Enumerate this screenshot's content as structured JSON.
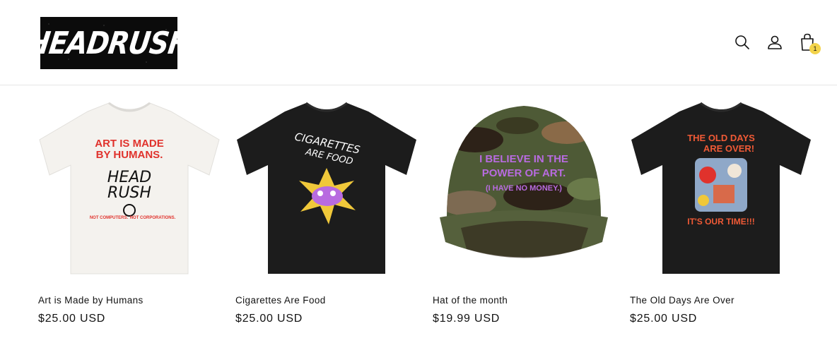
{
  "header": {
    "logo_text": "HEADRUSH",
    "icons": [
      "search-icon",
      "account-icon",
      "cart-icon"
    ],
    "cart_count": "1"
  },
  "products": [
    {
      "title": "Art is Made by Humans",
      "price": "$25.00 USD",
      "shirt_color": "#f4f2ee",
      "print_top": "ART IS MADE",
      "print_top2": "BY HUMANS.",
      "print_center1": "HEAD",
      "print_center2": "RUSH",
      "print_bottom_left": "NOT COMPUTERS.",
      "print_bottom_right": "NOT CORPORATIONS."
    },
    {
      "title": "Cigarettes Are Food",
      "price": "$25.00 USD",
      "shirt_color": "#1c1c1c",
      "print_top": "CIGARETTES",
      "print_top2": "ARE FOOD"
    },
    {
      "title": "Hat of the month",
      "price": "$19.99 USD",
      "print_line1": "I BELIEVE IN THE",
      "print_line2": "POWER OF ART.",
      "print_line3": "(I HAVE NO MONEY.)"
    },
    {
      "title": "The Old Days Are Over",
      "price": "$25.00 USD",
      "shirt_color": "#1c1c1c",
      "print_top": "THE OLD DAYS",
      "print_top2": "ARE OVER!",
      "print_bottom": "IT'S OUR TIME!!!"
    }
  ],
  "colors": {
    "red_print": "#e0322c",
    "purple_print": "#b86be0",
    "yellow_print": "#f0c83a",
    "orange_print": "#f05a36",
    "badge": "#f3d34a"
  }
}
